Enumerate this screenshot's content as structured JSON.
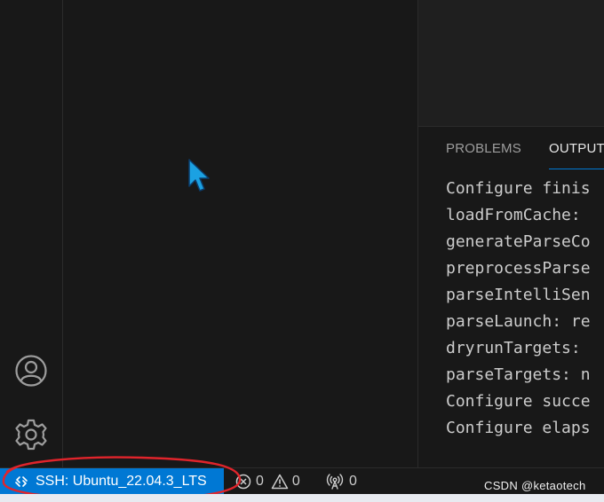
{
  "activity_bar": {
    "account_icon": "account-icon",
    "settings_icon": "gear-icon"
  },
  "panel": {
    "tabs": [
      {
        "label": "PROBLEMS"
      },
      {
        "label": "OUTPUT"
      }
    ],
    "active_tab": "OUTPUT",
    "output_lines": [
      "Configure finis",
      "loadFromCache: ",
      "generateParseCo",
      "preprocessParse",
      "parseIntelliSen",
      "parseLaunch: re",
      "dryrunTargets: ",
      "parseTargets: n",
      "Configure succe",
      "Configure elaps"
    ]
  },
  "statusbar": {
    "remote_label": "SSH: Ubuntu_22.04.3_LTS",
    "remote_icon": "remote-icon",
    "errors": "0",
    "warnings": "0",
    "ports": "0",
    "accent": "#0078d4"
  },
  "watermark": "CSDN @ketaotech",
  "colors": {
    "background": "#181818",
    "annotation": "#e0242b"
  }
}
